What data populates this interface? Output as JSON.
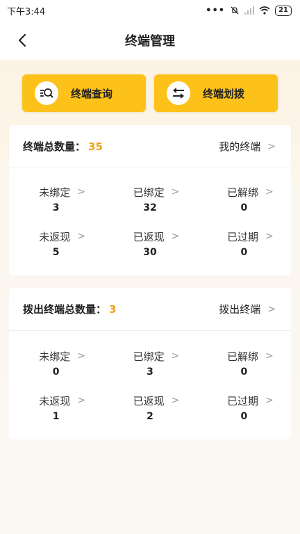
{
  "status_bar": {
    "time": "下午3:44",
    "dots": "•••",
    "battery": "21"
  },
  "header": {
    "title": "终端管理"
  },
  "actions": [
    {
      "label": "终端查询",
      "icon": "search-list-icon"
    },
    {
      "label": "终端划拨",
      "icon": "transfer-icon"
    }
  ],
  "colors": {
    "accent": "#fdc21a",
    "highlight_number": "#f0a01a"
  },
  "card1": {
    "total_label": "终端总数量：",
    "total_value": "35",
    "link_label": "我的终端",
    "stats": [
      {
        "label": "未绑定",
        "value": "3"
      },
      {
        "label": "已绑定",
        "value": "32"
      },
      {
        "label": "已解绑",
        "value": "0"
      },
      {
        "label": "未返现",
        "value": "5"
      },
      {
        "label": "已返现",
        "value": "30"
      },
      {
        "label": "已过期",
        "value": "0"
      }
    ]
  },
  "card2": {
    "total_label": "拨出终端总数量：",
    "total_value": "3",
    "link_label": "拨出终端",
    "stats": [
      {
        "label": "未绑定",
        "value": "0"
      },
      {
        "label": "已绑定",
        "value": "3"
      },
      {
        "label": "已解绑",
        "value": "0"
      },
      {
        "label": "未返现",
        "value": "1"
      },
      {
        "label": "已返现",
        "value": "2"
      },
      {
        "label": "已过期",
        "value": "0"
      }
    ]
  }
}
